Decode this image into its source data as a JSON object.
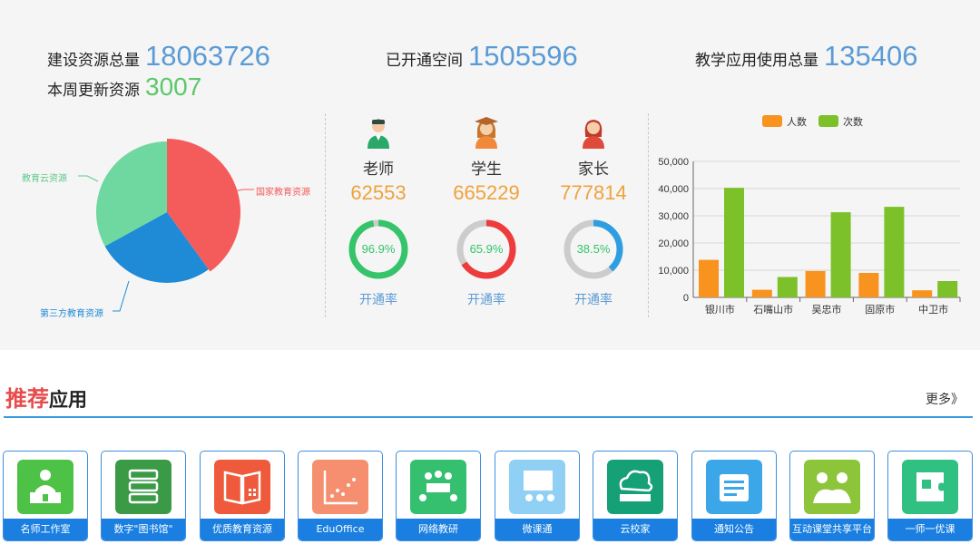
{
  "stats": {
    "total_resources_label": "建设资源总量",
    "total_resources_value": "18063726",
    "weekly_update_label": "本周更新资源",
    "weekly_update_value": "3007",
    "opened_space_label": "已开通空间",
    "opened_space_value": "1505596",
    "app_usage_label": "教学应用使用总量",
    "app_usage_value": "135406"
  },
  "pie": {
    "colors": [
      "#f45b5b",
      "#1f8ad6",
      "#6ed8a0"
    ],
    "slices": [
      {
        "name": "国家教育资源",
        "value": 40
      },
      {
        "name": "第三方教育资源",
        "value": 27
      },
      {
        "name": "教育云资源",
        "value": 33
      }
    ]
  },
  "users": [
    {
      "role": "老师",
      "count": "62553",
      "pct_label": "96.9%",
      "pct": 96.9,
      "ring_color": "#35c46a",
      "pct_color": "#35c46a",
      "rate_label": "开通率",
      "icon": "teacher-icon"
    },
    {
      "role": "学生",
      "count": "665229",
      "pct_label": "65.9%",
      "pct": 65.9,
      "ring_color": "#ee3b3b",
      "pct_color": "#35c46a",
      "rate_label": "开通率",
      "icon": "student-icon"
    },
    {
      "role": "家长",
      "count": "777814",
      "pct_label": "38.5%",
      "pct": 38.5,
      "ring_color": "#2d9fe0",
      "pct_color": "#35c46a",
      "rate_label": "开通率",
      "icon": "parent-icon"
    }
  ],
  "chart_data": {
    "type": "bar",
    "categories": [
      "银川市",
      "石嘴山市",
      "吴忠市",
      "固原市",
      "中卫市"
    ],
    "series": [
      {
        "name": "人数",
        "color": "#f7931e",
        "values": [
          13800,
          2800,
          9700,
          9000,
          2600
        ]
      },
      {
        "name": "次数",
        "color": "#7dc12a",
        "values": [
          40300,
          7500,
          31300,
          33300,
          6000
        ]
      }
    ],
    "ylim": [
      0,
      50000
    ],
    "yticks": [
      "0",
      "10,000",
      "20,000",
      "30,000",
      "40,000",
      "50,000"
    ],
    "legend_position": "top-center",
    "grid": true
  },
  "recommend": {
    "title_red": "推荐",
    "title_black": "应用",
    "more_label": "更多》"
  },
  "apps": [
    {
      "name": "名师工作室",
      "color": "#4dc247",
      "icon": "teacher-studio-icon"
    },
    {
      "name": "数字\"图书馆\"",
      "color": "#3a9a45",
      "icon": "library-icon"
    },
    {
      "name": "优质教育资源",
      "color": "#ef5a3c",
      "icon": "open-book-icon"
    },
    {
      "name": "EduOffice",
      "color": "#f58f6f",
      "icon": "edu-office-icon"
    },
    {
      "name": "网络教研",
      "color": "#34c06e",
      "icon": "meeting-icon"
    },
    {
      "name": "微课通",
      "color": "#8fd0f4",
      "icon": "presentation-icon"
    },
    {
      "name": "云校家",
      "color": "#16a075",
      "icon": "cloud-school-icon"
    },
    {
      "name": "通知公告",
      "color": "#3ba7e8",
      "icon": "notice-board-icon"
    },
    {
      "name": "互动课堂共享平台",
      "color": "#8cc43a",
      "icon": "interactive-class-icon"
    },
    {
      "name": "一师一优课",
      "color": "#2fc082",
      "icon": "puzzle-icon"
    }
  ]
}
